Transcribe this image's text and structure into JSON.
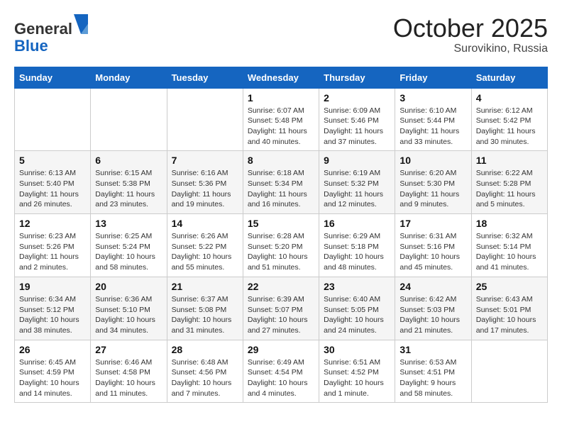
{
  "header": {
    "logo_general": "General",
    "logo_blue": "Blue",
    "month": "October 2025",
    "location": "Surovikino, Russia"
  },
  "weekdays": [
    "Sunday",
    "Monday",
    "Tuesday",
    "Wednesday",
    "Thursday",
    "Friday",
    "Saturday"
  ],
  "weeks": [
    [
      {
        "day": "",
        "content": ""
      },
      {
        "day": "",
        "content": ""
      },
      {
        "day": "",
        "content": ""
      },
      {
        "day": "1",
        "content": "Sunrise: 6:07 AM\nSunset: 5:48 PM\nDaylight: 11 hours\nand 40 minutes."
      },
      {
        "day": "2",
        "content": "Sunrise: 6:09 AM\nSunset: 5:46 PM\nDaylight: 11 hours\nand 37 minutes."
      },
      {
        "day": "3",
        "content": "Sunrise: 6:10 AM\nSunset: 5:44 PM\nDaylight: 11 hours\nand 33 minutes."
      },
      {
        "day": "4",
        "content": "Sunrise: 6:12 AM\nSunset: 5:42 PM\nDaylight: 11 hours\nand 30 minutes."
      }
    ],
    [
      {
        "day": "5",
        "content": "Sunrise: 6:13 AM\nSunset: 5:40 PM\nDaylight: 11 hours\nand 26 minutes."
      },
      {
        "day": "6",
        "content": "Sunrise: 6:15 AM\nSunset: 5:38 PM\nDaylight: 11 hours\nand 23 minutes."
      },
      {
        "day": "7",
        "content": "Sunrise: 6:16 AM\nSunset: 5:36 PM\nDaylight: 11 hours\nand 19 minutes."
      },
      {
        "day": "8",
        "content": "Sunrise: 6:18 AM\nSunset: 5:34 PM\nDaylight: 11 hours\nand 16 minutes."
      },
      {
        "day": "9",
        "content": "Sunrise: 6:19 AM\nSunset: 5:32 PM\nDaylight: 11 hours\nand 12 minutes."
      },
      {
        "day": "10",
        "content": "Sunrise: 6:20 AM\nSunset: 5:30 PM\nDaylight: 11 hours\nand 9 minutes."
      },
      {
        "day": "11",
        "content": "Sunrise: 6:22 AM\nSunset: 5:28 PM\nDaylight: 11 hours\nand 5 minutes."
      }
    ],
    [
      {
        "day": "12",
        "content": "Sunrise: 6:23 AM\nSunset: 5:26 PM\nDaylight: 11 hours\nand 2 minutes."
      },
      {
        "day": "13",
        "content": "Sunrise: 6:25 AM\nSunset: 5:24 PM\nDaylight: 10 hours\nand 58 minutes."
      },
      {
        "day": "14",
        "content": "Sunrise: 6:26 AM\nSunset: 5:22 PM\nDaylight: 10 hours\nand 55 minutes."
      },
      {
        "day": "15",
        "content": "Sunrise: 6:28 AM\nSunset: 5:20 PM\nDaylight: 10 hours\nand 51 minutes."
      },
      {
        "day": "16",
        "content": "Sunrise: 6:29 AM\nSunset: 5:18 PM\nDaylight: 10 hours\nand 48 minutes."
      },
      {
        "day": "17",
        "content": "Sunrise: 6:31 AM\nSunset: 5:16 PM\nDaylight: 10 hours\nand 45 minutes."
      },
      {
        "day": "18",
        "content": "Sunrise: 6:32 AM\nSunset: 5:14 PM\nDaylight: 10 hours\nand 41 minutes."
      }
    ],
    [
      {
        "day": "19",
        "content": "Sunrise: 6:34 AM\nSunset: 5:12 PM\nDaylight: 10 hours\nand 38 minutes."
      },
      {
        "day": "20",
        "content": "Sunrise: 6:36 AM\nSunset: 5:10 PM\nDaylight: 10 hours\nand 34 minutes."
      },
      {
        "day": "21",
        "content": "Sunrise: 6:37 AM\nSunset: 5:08 PM\nDaylight: 10 hours\nand 31 minutes."
      },
      {
        "day": "22",
        "content": "Sunrise: 6:39 AM\nSunset: 5:07 PM\nDaylight: 10 hours\nand 27 minutes."
      },
      {
        "day": "23",
        "content": "Sunrise: 6:40 AM\nSunset: 5:05 PM\nDaylight: 10 hours\nand 24 minutes."
      },
      {
        "day": "24",
        "content": "Sunrise: 6:42 AM\nSunset: 5:03 PM\nDaylight: 10 hours\nand 21 minutes."
      },
      {
        "day": "25",
        "content": "Sunrise: 6:43 AM\nSunset: 5:01 PM\nDaylight: 10 hours\nand 17 minutes."
      }
    ],
    [
      {
        "day": "26",
        "content": "Sunrise: 6:45 AM\nSunset: 4:59 PM\nDaylight: 10 hours\nand 14 minutes."
      },
      {
        "day": "27",
        "content": "Sunrise: 6:46 AM\nSunset: 4:58 PM\nDaylight: 10 hours\nand 11 minutes."
      },
      {
        "day": "28",
        "content": "Sunrise: 6:48 AM\nSunset: 4:56 PM\nDaylight: 10 hours\nand 7 minutes."
      },
      {
        "day": "29",
        "content": "Sunrise: 6:49 AM\nSunset: 4:54 PM\nDaylight: 10 hours\nand 4 minutes."
      },
      {
        "day": "30",
        "content": "Sunrise: 6:51 AM\nSunset: 4:52 PM\nDaylight: 10 hours\nand 1 minute."
      },
      {
        "day": "31",
        "content": "Sunrise: 6:53 AM\nSunset: 4:51 PM\nDaylight: 9 hours\nand 58 minutes."
      },
      {
        "day": "",
        "content": ""
      }
    ]
  ]
}
